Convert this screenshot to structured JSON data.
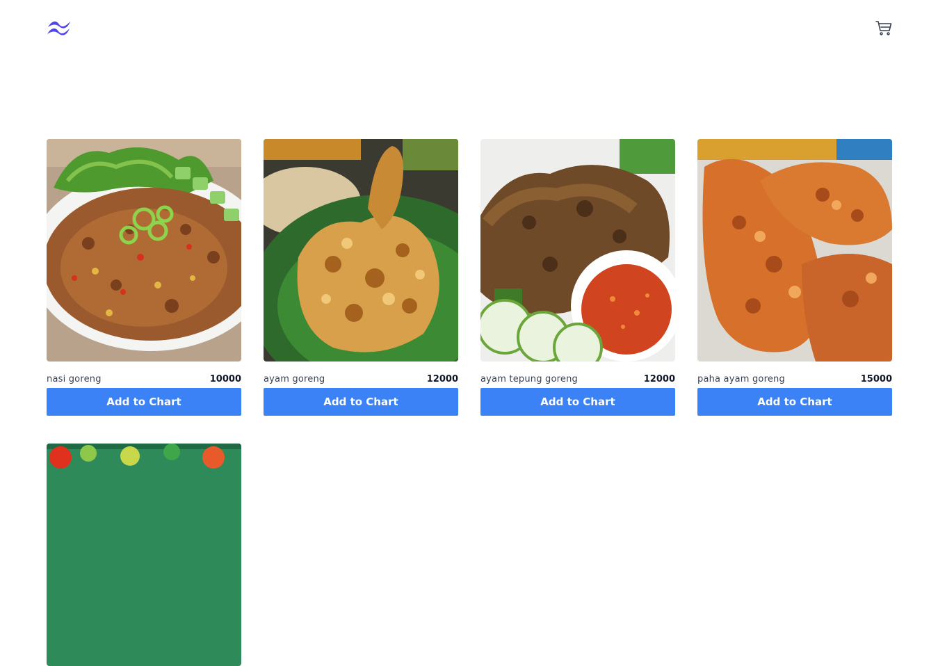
{
  "header": {
    "logo_icon": "tailwind-logo-icon",
    "cart_icon": "shopping-cart-icon"
  },
  "colors": {
    "accent": "#3b82f6",
    "logo": "#4f46e5"
  },
  "products": [
    {
      "name": "nasi goreng",
      "price": "10000",
      "button_label": "Add to Chart",
      "image": "fried-rice-photo"
    },
    {
      "name": "ayam goreng",
      "price": "12000",
      "button_label": "Add to Chart",
      "image": "fried-chicken-photo"
    },
    {
      "name": "ayam tepung goreng",
      "price": "12000",
      "button_label": "Add to Chart",
      "image": "chicken-with-sambal-photo"
    },
    {
      "name": "paha ayam goreng",
      "price": "15000",
      "button_label": "Add to Chart",
      "image": "chicken-drumsticks-photo"
    },
    {
      "name": "",
      "price": "",
      "button_label": "",
      "image": "salad-photo"
    }
  ]
}
